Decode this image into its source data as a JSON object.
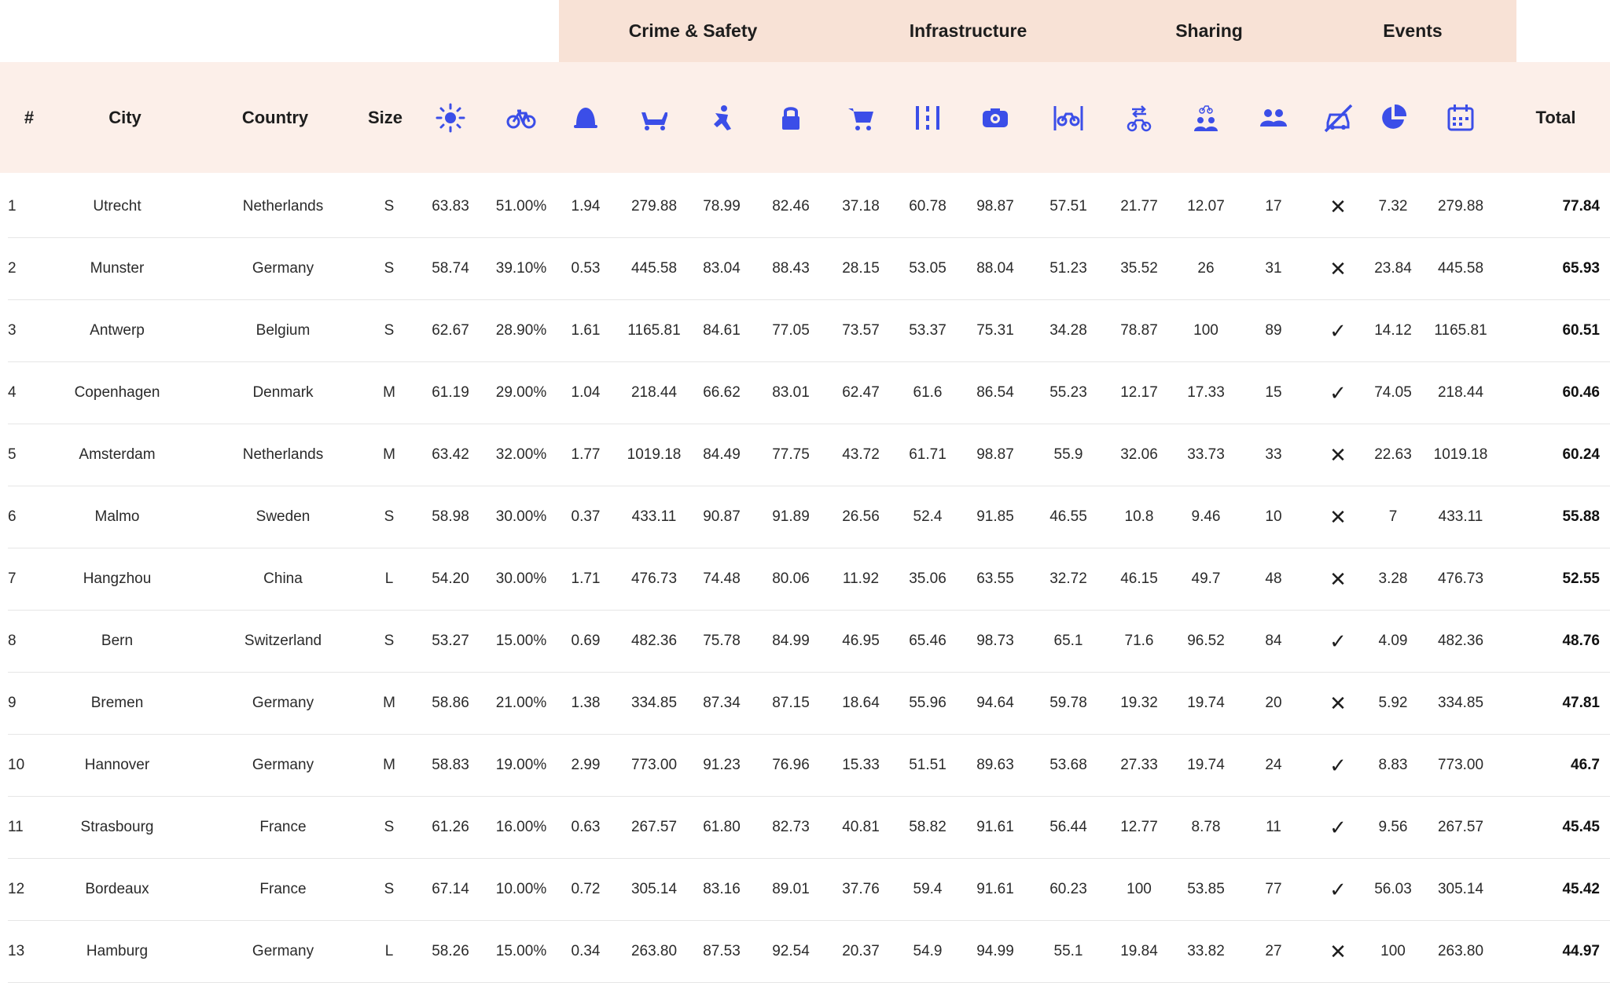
{
  "groups": [
    {
      "label": "Crime & Safety"
    },
    {
      "label": "Infrastructure"
    },
    {
      "label": "Sharing"
    },
    {
      "label": "Events"
    }
  ],
  "headers": {
    "rank": "#",
    "city": "City",
    "country": "Country",
    "size": "Size",
    "total": "Total"
  },
  "metric_icons": [
    "sun-icon",
    "bicycle-icon",
    "helmet-icon",
    "stolen-bicycle-icon",
    "accident-icon",
    "lock-icon",
    "shopping-cart-icon",
    "bike-lane-icon",
    "camera-icon",
    "bike-parking-icon",
    "bike-sharing-icon",
    "cycling-community-icon",
    "people-icon",
    "car-free-icon",
    "pie-chart-icon",
    "calendar-icon"
  ],
  "accent_color": "#3b4ee8",
  "rows": [
    {
      "rank": "1",
      "city": "Utrecht",
      "country": "Netherlands",
      "size": "S",
      "v": [
        "63.83",
        "51.00%",
        "1.94",
        "279.88",
        "78.99",
        "82.46",
        "37.18",
        "60.78",
        "98.87",
        "57.51",
        "21.77",
        "12.07",
        "17",
        "✕",
        "7.32",
        "279.88"
      ],
      "total": "77.84"
    },
    {
      "rank": "2",
      "city": "Munster",
      "country": "Germany",
      "size": "S",
      "v": [
        "58.74",
        "39.10%",
        "0.53",
        "445.58",
        "83.04",
        "88.43",
        "28.15",
        "53.05",
        "88.04",
        "51.23",
        "35.52",
        "26",
        "31",
        "✕",
        "23.84",
        "445.58"
      ],
      "total": "65.93"
    },
    {
      "rank": "3",
      "city": "Antwerp",
      "country": "Belgium",
      "size": "S",
      "v": [
        "62.67",
        "28.90%",
        "1.61",
        "1165.81",
        "84.61",
        "77.05",
        "73.57",
        "53.37",
        "75.31",
        "34.28",
        "78.87",
        "100",
        "89",
        "✓",
        "14.12",
        "1165.81"
      ],
      "total": "60.51"
    },
    {
      "rank": "4",
      "city": "Copenhagen",
      "country": "Denmark",
      "size": "M",
      "v": [
        "61.19",
        "29.00%",
        "1.04",
        "218.44",
        "66.62",
        "83.01",
        "62.47",
        "61.6",
        "86.54",
        "55.23",
        "12.17",
        "17.33",
        "15",
        "✓",
        "74.05",
        "218.44"
      ],
      "total": "60.46"
    },
    {
      "rank": "5",
      "city": "Amsterdam",
      "country": "Netherlands",
      "size": "M",
      "v": [
        "63.42",
        "32.00%",
        "1.77",
        "1019.18",
        "84.49",
        "77.75",
        "43.72",
        "61.71",
        "98.87",
        "55.9",
        "32.06",
        "33.73",
        "33",
        "✕",
        "22.63",
        "1019.18"
      ],
      "total": "60.24"
    },
    {
      "rank": "6",
      "city": "Malmo",
      "country": "Sweden",
      "size": "S",
      "v": [
        "58.98",
        "30.00%",
        "0.37",
        "433.11",
        "90.87",
        "91.89",
        "26.56",
        "52.4",
        "91.85",
        "46.55",
        "10.8",
        "9.46",
        "10",
        "✕",
        "7",
        "433.11"
      ],
      "total": "55.88"
    },
    {
      "rank": "7",
      "city": "Hangzhou",
      "country": "China",
      "size": "L",
      "v": [
        "54.20",
        "30.00%",
        "1.71",
        "476.73",
        "74.48",
        "80.06",
        "11.92",
        "35.06",
        "63.55",
        "32.72",
        "46.15",
        "49.7",
        "48",
        "✕",
        "3.28",
        "476.73"
      ],
      "total": "52.55"
    },
    {
      "rank": "8",
      "city": "Bern",
      "country": "Switzerland",
      "size": "S",
      "v": [
        "53.27",
        "15.00%",
        "0.69",
        "482.36",
        "75.78",
        "84.99",
        "46.95",
        "65.46",
        "98.73",
        "65.1",
        "71.6",
        "96.52",
        "84",
        "✓",
        "4.09",
        "482.36"
      ],
      "total": "48.76"
    },
    {
      "rank": "9",
      "city": "Bremen",
      "country": "Germany",
      "size": "M",
      "v": [
        "58.86",
        "21.00%",
        "1.38",
        "334.85",
        "87.34",
        "87.15",
        "18.64",
        "55.96",
        "94.64",
        "59.78",
        "19.32",
        "19.74",
        "20",
        "✕",
        "5.92",
        "334.85"
      ],
      "total": "47.81"
    },
    {
      "rank": "10",
      "city": "Hannover",
      "country": "Germany",
      "size": "M",
      "v": [
        "58.83",
        "19.00%",
        "2.99",
        "773.00",
        "91.23",
        "76.96",
        "15.33",
        "51.51",
        "89.63",
        "53.68",
        "27.33",
        "19.74",
        "24",
        "✓",
        "8.83",
        "773.00"
      ],
      "total": "46.7"
    },
    {
      "rank": "11",
      "city": "Strasbourg",
      "country": "France",
      "size": "S",
      "v": [
        "61.26",
        "16.00%",
        "0.63",
        "267.57",
        "61.80",
        "82.73",
        "40.81",
        "58.82",
        "91.61",
        "56.44",
        "12.77",
        "8.78",
        "11",
        "✓",
        "9.56",
        "267.57"
      ],
      "total": "45.45"
    },
    {
      "rank": "12",
      "city": "Bordeaux",
      "country": "France",
      "size": "S",
      "v": [
        "67.14",
        "10.00%",
        "0.72",
        "305.14",
        "83.16",
        "89.01",
        "37.76",
        "59.4",
        "91.61",
        "60.23",
        "100",
        "53.85",
        "77",
        "✓",
        "56.03",
        "305.14"
      ],
      "total": "45.42"
    },
    {
      "rank": "13",
      "city": "Hamburg",
      "country": "Germany",
      "size": "L",
      "v": [
        "58.26",
        "15.00%",
        "0.34",
        "263.80",
        "87.53",
        "92.54",
        "20.37",
        "54.9",
        "94.99",
        "55.1",
        "19.84",
        "33.82",
        "27",
        "✕",
        "100",
        "263.80"
      ],
      "total": "44.97"
    }
  ]
}
